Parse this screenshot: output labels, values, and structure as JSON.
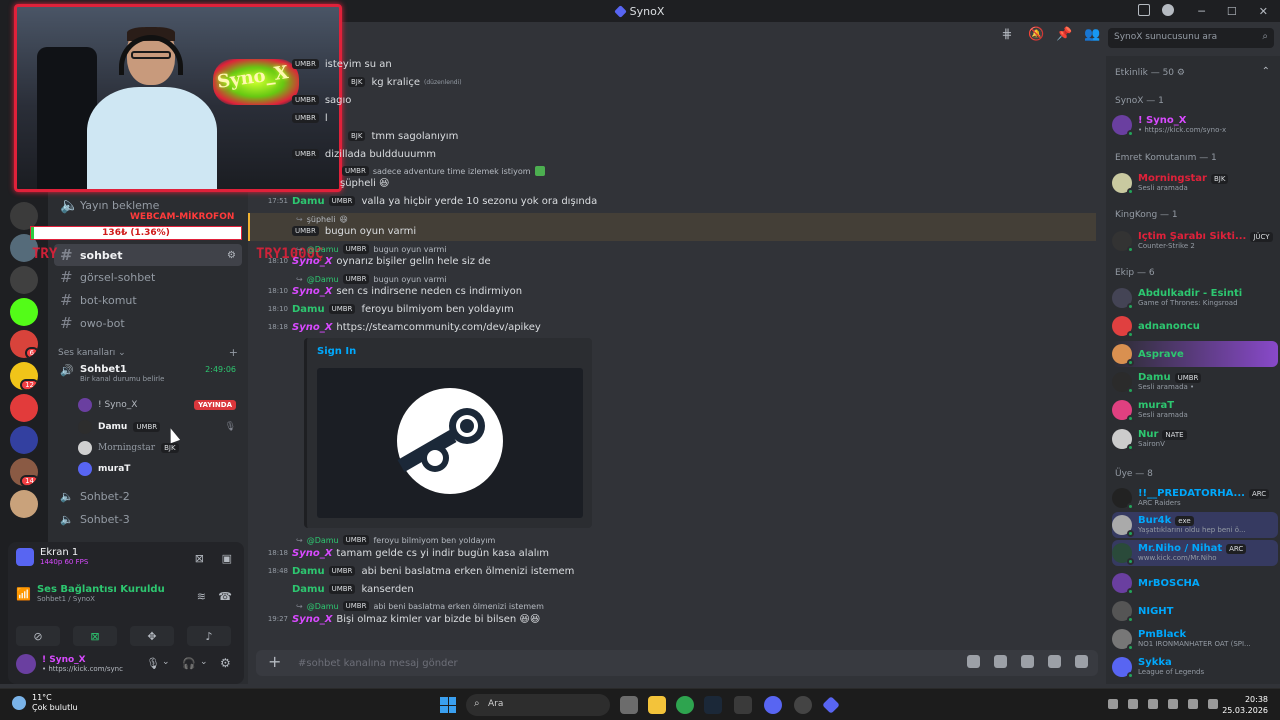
{
  "window": {
    "title": "SynoX"
  },
  "search": {
    "placeholder": "SynoX sunucusunu ara"
  },
  "stream_overlay": {
    "neon_text": "Syno_X",
    "webcam_label": "WEBCAM-MİKROFON",
    "goal_text": "136₺ (1.36%)",
    "goal_progress": 0.0136,
    "try_text_1": "TRY",
    "try_text_2": "TRY1000Ç"
  },
  "servers": [
    {
      "name": "server-1",
      "color": "#3b3b3b",
      "badge": ""
    },
    {
      "name": "server-2",
      "color": "#556b7a",
      "badge": ""
    },
    {
      "name": "server-3",
      "color": "#404040",
      "badge": ""
    },
    {
      "name": "kick",
      "color": "#53fc18",
      "badge": ""
    },
    {
      "name": "server-5",
      "color": "#d8433b",
      "badge": "6"
    },
    {
      "name": "server-6",
      "color": "#f0c419",
      "badge": "12"
    },
    {
      "name": "server-7",
      "color": "#e23b3b",
      "badge": ""
    },
    {
      "name": "server-8",
      "color": "#3340a0",
      "badge": ""
    },
    {
      "name": "server-9",
      "color": "#8a5a44",
      "badge": "14"
    },
    {
      "name": "server-10",
      "color": "#c9a27b",
      "badge": ""
    }
  ],
  "sidebar": {
    "channels": [
      {
        "label": "Yayın bekleme",
        "type": "voice"
      },
      {
        "label": "sohbet",
        "type": "text",
        "active": true
      },
      {
        "label": "görsel-sohbet",
        "type": "text"
      },
      {
        "label": "bot-komut",
        "type": "text"
      },
      {
        "label": "owo-bot",
        "type": "text"
      }
    ],
    "voice_section": "Ses kanalları",
    "voice_channel": {
      "name": "Sohbet1",
      "timer": "2:49:06",
      "status": "Bir kanal durumu belirle"
    },
    "voice_users": [
      {
        "name": "! Syno_X",
        "badge": "YAYINDA",
        "tag": ""
      },
      {
        "name": "Damu",
        "badge": "",
        "tag": "UMBR"
      },
      {
        "name": "Morningstar",
        "badge": "",
        "tag": "BJK"
      },
      {
        "name": "muraT",
        "badge": "",
        "tag": ""
      }
    ],
    "other_voice": [
      "Sohbet-2",
      "Sohbet-3"
    ]
  },
  "voice_panel": {
    "screen_title": "Ekran 1",
    "screen_sub": "1440p 60 FPS",
    "conn_title": "Ses Bağlantısı Kuruldu",
    "conn_sub": "Sohbet1 / SynoX",
    "user_name": "! Syno_X",
    "user_sub": "• https://kick.com/sync"
  },
  "messages": [
    {
      "time": "",
      "author": "",
      "tag": "UMBR",
      "text": "isteyim su an"
    },
    {
      "time": "",
      "author": "",
      "tag": "BJK",
      "text": "kg kraliçe",
      "edited": "(düzenlendi)"
    },
    {
      "time": "",
      "author": "",
      "tag": "UMBR",
      "text": "sagıo"
    },
    {
      "time": "",
      "author": "",
      "tag": "UMBR",
      "text": "l"
    },
    {
      "time": "",
      "author": "",
      "tag": "BJK",
      "text": "tmm sagolanıyım"
    },
    {
      "time": "",
      "author": "",
      "tag": "UMBR",
      "text": "dizillada buldduuumm"
    },
    {
      "time": "",
      "author": "",
      "tag": "UMBR",
      "text": "sadece adventure time izlemek istiyom"
    },
    {
      "time": "",
      "author": "",
      "tag": "",
      "text": "şüpheli"
    },
    {
      "time": "17:51",
      "author": "Damu",
      "tag": "UMBR",
      "text": "valla ya hiçbir yerde 10 sezonu yok ora dışında"
    },
    {
      "time": "",
      "author": "",
      "tag": "UMBR",
      "text": "bugun oyun varmi"
    },
    {
      "time": "18:10",
      "author": "Syno_X",
      "tag": "",
      "text": "oynarız bişiler gelin hele siz de"
    },
    {
      "time": "18:10",
      "author": "Syno_X",
      "tag": "",
      "text": "sen cs indirsene neden cs indirmiyon"
    },
    {
      "time": "18:10",
      "author": "Damu",
      "tag": "UMBR",
      "text": "feroyu bilmiyom ben yoldayım"
    },
    {
      "time": "18:18",
      "author": "Syno_X",
      "tag": "",
      "text": "https://steamcommunity.com/dev/apikey"
    },
    {
      "time": "18:18",
      "author": "Syno_X",
      "tag": "",
      "text": "tamam gelde cs yi indir bugün kasa alalım"
    },
    {
      "time": "18:48",
      "author": "Damu",
      "tag": "UMBR",
      "text": "abi beni baslatma erken ölmenizi istemem"
    },
    {
      "time": "",
      "author": "Damu",
      "tag": "UMBR",
      "text": "kanserden"
    },
    {
      "time": "19:27",
      "author": "Syno_X",
      "tag": "",
      "text": "Bişi olmaz kimler var bizde bi bilsen 😆😆"
    }
  ],
  "replies": [
    {
      "mention": "",
      "text": "şüpheli"
    },
    {
      "mention": "@Damu",
      "tag": "UMBR",
      "text": "bugun oyun varmi"
    },
    {
      "mention": "@Damu",
      "tag": "UMBR",
      "text": "bugun oyun varmi"
    },
    {
      "mention": "@Damu",
      "tag": "UMBR",
      "text": "feroyu bilmiyom ben yoldayım"
    },
    {
      "mention": "@Damu",
      "tag": "UMBR",
      "text": "abi beni baslatma erken ölmenizi istemem"
    }
  ],
  "embed": {
    "title": "Sign In"
  },
  "composer": {
    "placeholder": "#sohbet kanalına mesaj gönder"
  },
  "members": {
    "header": "Etkinlik — 50",
    "groups": [
      {
        "label": "SynoX — 1"
      },
      {
        "label": "Emret Komutanım — 1"
      },
      {
        "label": "KingKong — 1"
      },
      {
        "label": "Ekip — 6"
      },
      {
        "label": "Üye — 8"
      }
    ],
    "list": [
      {
        "name": "! Syno_X",
        "sub": "• https://kick.com/syno-x",
        "color": "#d84aff",
        "tag": ""
      },
      {
        "name": "Morningstar",
        "sub": "Sesli aramada",
        "color": "#e0213a",
        "tag": "BJK"
      },
      {
        "name": "İçtim Şarabı Sikti...",
        "sub": "Counter-Strike 2",
        "color": "#e0213a",
        "tag": "JÜCY"
      },
      {
        "name": "Abdulkadir - Esinti",
        "sub": "Game of Thrones: Kingsroad",
        "color": "#2dc770",
        "tag": ""
      },
      {
        "name": "adnanoncu",
        "sub": "",
        "color": "#2dc770",
        "tag": ""
      },
      {
        "name": "Asprave",
        "sub": "",
        "color": "#2dc770",
        "tag": ""
      },
      {
        "name": "Damu",
        "sub": "Sesli aramada •",
        "color": "#2dc770",
        "tag": "UMBR"
      },
      {
        "name": "muraT",
        "sub": "Sesli aramada",
        "color": "#2dc770",
        "tag": ""
      },
      {
        "name": "Nur",
        "sub": "SaironV",
        "color": "#2dc770",
        "tag": "NATE"
      },
      {
        "name": "!!__PREDATORHA...",
        "sub": "ARC Raiders",
        "color": "#00a8fc",
        "tag": "ARC"
      },
      {
        "name": "Bur4k",
        "sub": "Yaşattıklarını oldu hep beni ö...",
        "color": "#00a8fc",
        "tag": "exe"
      },
      {
        "name": "Mr.Niho / Nihat",
        "sub": "www.kick.com/Mr.Niho",
        "color": "#00a8fc",
        "tag": "ARC"
      },
      {
        "name": "MrBOSCHA",
        "sub": "",
        "color": "#00a8fc",
        "tag": ""
      },
      {
        "name": "NIGHT",
        "sub": "",
        "color": "#00a8fc",
        "tag": ""
      },
      {
        "name": "PmBlack",
        "sub": "NO1 IRONMANHATER OAT (SPI...",
        "color": "#00a8fc",
        "tag": ""
      },
      {
        "name": "Sykka",
        "sub": "League of Legends",
        "color": "#00a8fc",
        "tag": ""
      }
    ]
  },
  "taskbar": {
    "temp": "11°C",
    "weather": "Çok bulutlu",
    "search": "Ara",
    "time": "20:38",
    "date": "25.03.2026"
  }
}
